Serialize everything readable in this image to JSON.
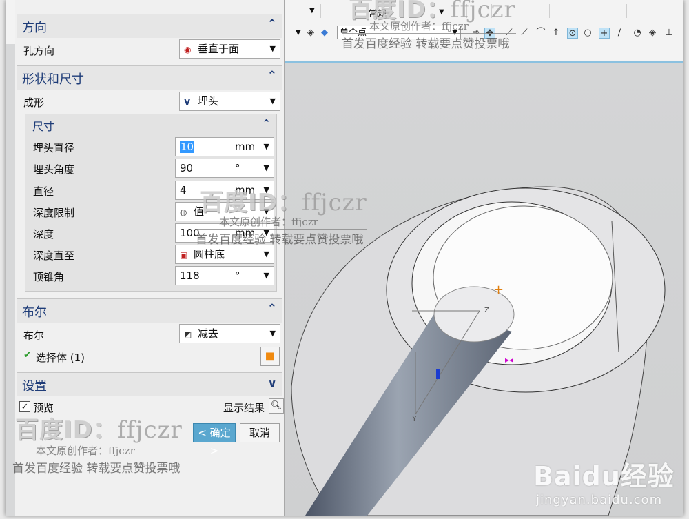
{
  "toolbar": {
    "filter_label": "常规",
    "snap_select": "单个点"
  },
  "direction": {
    "title": "方向",
    "hole_dir_label": "孔方向",
    "hole_dir_value": "垂直于面"
  },
  "shape": {
    "title": "形状和尺寸",
    "form_label": "成形",
    "form_value": "埋头",
    "dims": {
      "title": "尺寸",
      "rows": [
        {
          "label": "埋头直径",
          "value": "10",
          "unit": "mm"
        },
        {
          "label": "埋头角度",
          "value": "90",
          "unit": "°"
        },
        {
          "label": "直径",
          "value": "4",
          "unit": "mm"
        },
        {
          "label": "深度限制",
          "value": "值",
          "unit": ""
        },
        {
          "label": "深度",
          "value": "100",
          "unit": "mm"
        },
        {
          "label": "深度直至",
          "value": "圆柱底",
          "unit": ""
        },
        {
          "label": "顶锥角",
          "value": "118",
          "unit": "°"
        }
      ]
    }
  },
  "boolean": {
    "title": "布尔",
    "label": "布尔",
    "value": "减去",
    "select_body": "选择体 (1)"
  },
  "settings": {
    "title": "设置"
  },
  "footer": {
    "preview_label": "预览",
    "show_result": "显示结果",
    "ok": "< 确定 >",
    "cancel": "取消"
  },
  "watermark": {
    "id_prefix": "百度ID：",
    "id_name": "ffjczr",
    "author": "本文原创作者：ffjczr",
    "note": "首发百度经验 转载要点赞投票哦",
    "author_top": "本文原创作者：ffjczr",
    "baidu_logo": "Baidu经验",
    "baidu_url": "jingyan.baidu.com"
  }
}
